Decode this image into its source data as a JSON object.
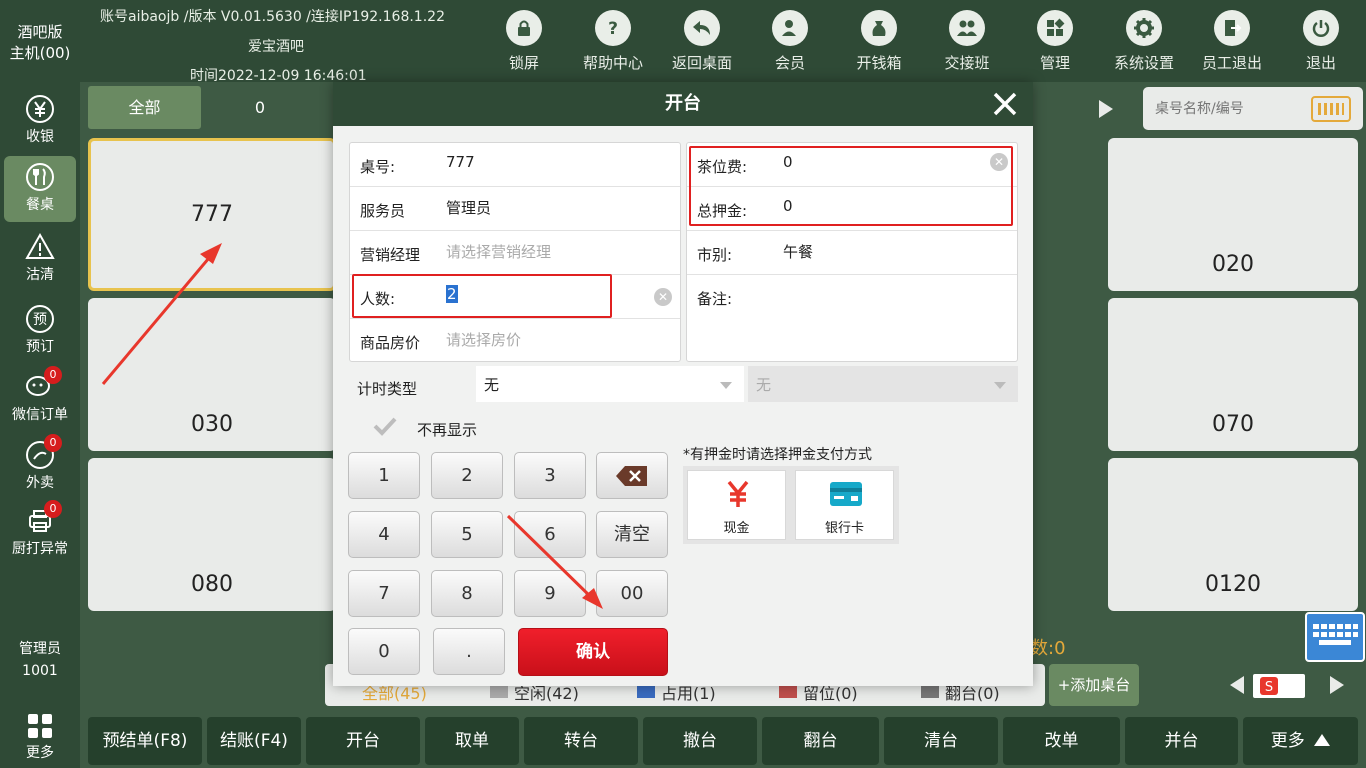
{
  "sidebar": {
    "brand_line1": "酒吧版",
    "brand_line2": "主机(00)",
    "items": [
      {
        "label": "收银",
        "badge": ""
      },
      {
        "label": "餐桌",
        "badge": ""
      },
      {
        "label": "沽清",
        "badge": ""
      },
      {
        "label": "预订",
        "badge": ""
      },
      {
        "label": "微信订单",
        "badge": "0"
      },
      {
        "label": "外卖",
        "badge": "0"
      },
      {
        "label": "厨打异常",
        "badge": "0"
      }
    ],
    "user_name": "管理员",
    "user_id": "1001",
    "more": "更多"
  },
  "header": {
    "account_line": "账号aibaojb /版本 V0.01.5630 /连接IP192.168.1.22",
    "shop_name": "爱宝酒吧",
    "time_line": "时间2022-12-09 16:46:01",
    "toolbar": [
      {
        "label": "锁屏",
        "icon": "lock-icon"
      },
      {
        "label": "帮助中心",
        "icon": "help-icon"
      },
      {
        "label": "返回桌面",
        "icon": "back-icon"
      },
      {
        "label": "会员",
        "icon": "member-icon"
      },
      {
        "label": "开钱箱",
        "icon": "cashbox-icon"
      },
      {
        "label": "交接班",
        "icon": "handover-icon"
      },
      {
        "label": "管理",
        "icon": "manage-icon"
      },
      {
        "label": "系统设置",
        "icon": "gear-icon"
      },
      {
        "label": "员工退出",
        "icon": "staff-exit-icon"
      },
      {
        "label": "退出",
        "icon": "power-icon"
      }
    ]
  },
  "board": {
    "filter_all": "全部",
    "filter_zero": "0",
    "search_placeholder": "桌号名称/编号",
    "tiles": [
      "777",
      "020",
      "030",
      "070",
      "080",
      "0120"
    ],
    "count_text": "数:0",
    "legend": [
      "全部(45)",
      "空闲(42)",
      "占用(1)",
      "留位(0)",
      "翻台(0)"
    ],
    "add_table": "+添加桌台"
  },
  "bottom_bar": [
    "预结单(F8)",
    "结账(F4)",
    "开台",
    "取单",
    "转台",
    "撤台",
    "翻台",
    "清台",
    "改单",
    "并台",
    "更多"
  ],
  "dialog": {
    "title": "开台",
    "left_form": [
      {
        "label": "桌号:",
        "value": "777",
        "placeholder": ""
      },
      {
        "label": "服务员",
        "value": "管理员",
        "placeholder": ""
      },
      {
        "label": "营销经理",
        "value": "",
        "placeholder": "请选择营销经理"
      },
      {
        "label": "人数:",
        "value": "2",
        "placeholder": ""
      },
      {
        "label": "商品房价",
        "value": "",
        "placeholder": "请选择房价"
      }
    ],
    "right_form": [
      {
        "label": "茶位费:",
        "value": "0"
      },
      {
        "label": "总押金:",
        "value": "0"
      },
      {
        "label": "市别:",
        "value": "午餐"
      },
      {
        "label": "备注:",
        "value": ""
      }
    ],
    "timing_label": "计时类型",
    "timing_value": "无",
    "timing_value2": "无",
    "no_show_again": "不再显示",
    "keypad": [
      "1",
      "2",
      "3",
      "4",
      "5",
      "6",
      "清空",
      "7",
      "8",
      "9",
      "00",
      "0",
      "."
    ],
    "confirm": "确认",
    "deposit_note": "*有押金时请选择押金支付方式",
    "pay_methods": [
      {
        "label": "现金",
        "icon": "yuan-icon",
        "color": "#e8372c"
      },
      {
        "label": "银行卡",
        "icon": "bank-card-icon",
        "color": "#16a9c9"
      }
    ]
  },
  "colors": {
    "header_bg": "#2f4a36",
    "accent_green": "#6a8a62",
    "highlight_red": "#e02020",
    "confirm_red": "#e0141e",
    "selected_border": "#e8c34e"
  }
}
